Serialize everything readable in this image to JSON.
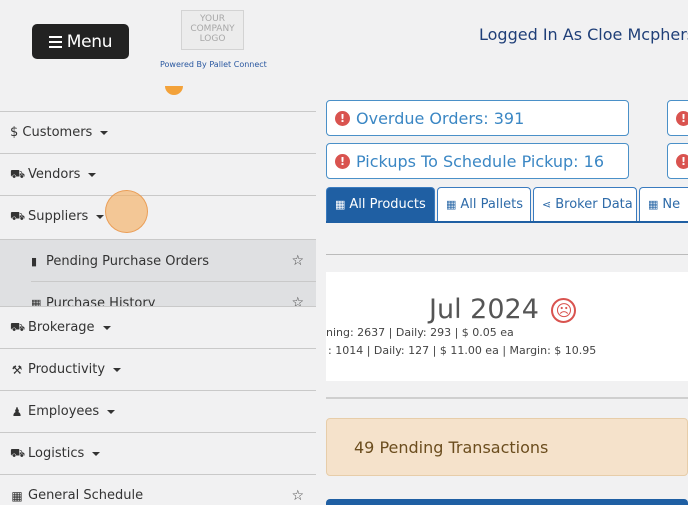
{
  "header": {
    "menu_label": "Menu",
    "logo_text": "YOUR COMPANY LOGO",
    "powered_by": "Powered By Pallet Connect",
    "logged_in": "Logged In As Cloe Mcphers"
  },
  "sidebar": {
    "items": [
      {
        "label": "$ Customers",
        "icon": "dollar-icon"
      },
      {
        "label": "Vendors",
        "icon": "truck-icon"
      },
      {
        "label": "Suppliers",
        "icon": "truck-loading-icon"
      },
      {
        "label": "Brokerage",
        "icon": "truck-icon"
      },
      {
        "label": "Productivity",
        "icon": "hammer-icon"
      },
      {
        "label": "Employees",
        "icon": "person-icon"
      },
      {
        "label": "Logistics",
        "icon": "truck-icon"
      },
      {
        "label": "General Schedule",
        "icon": "calendar-icon"
      }
    ],
    "sub_items": [
      {
        "label": "Pending Purchase Orders",
        "icon": "clipboard-icon"
      },
      {
        "label": "Purchase History",
        "icon": "table-icon"
      }
    ]
  },
  "alerts": {
    "overdue": "Overdue Orders: 391",
    "pickups": "Pickups To Schedule Pickup: 16"
  },
  "tabs": [
    {
      "label": "All Products"
    },
    {
      "label": "All Pallets"
    },
    {
      "label": "Broker Data"
    },
    {
      "label": "Ne"
    }
  ],
  "summary": {
    "month": "Jul 2024",
    "line1": "ning: 2637 | Daily: 293 | $ 0.05 ea",
    "line2": ": 1014 | Daily: 127 | $ 11.00 ea | Margin: $ 10.95"
  },
  "pending": "49 Pending Transactions",
  "colors": {
    "primary": "#1f5fa3",
    "alert": "#d9534f",
    "pending_bg": "#f5e2cb"
  }
}
